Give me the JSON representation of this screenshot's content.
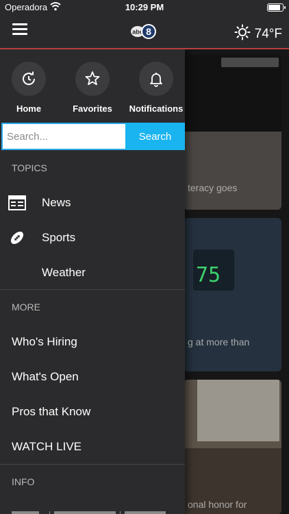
{
  "status_bar": {
    "carrier": "Operadora",
    "time": "10:29 PM"
  },
  "header": {
    "menu_icon": "hamburger-icon",
    "logo_icon": "abc8-logo",
    "weather_icon": "sun-icon",
    "temperature": "74°F"
  },
  "drawer": {
    "quick_actions": [
      {
        "label": "Home",
        "icon": "history-icon"
      },
      {
        "label": "Favorites",
        "icon": "star-icon"
      },
      {
        "label": "Notifications",
        "icon": "bell-icon"
      }
    ],
    "search": {
      "placeholder": "Search...",
      "button_label": "Search"
    },
    "topics": {
      "heading": "TOPICS",
      "items": [
        {
          "label": "News",
          "icon": "newspaper-icon"
        },
        {
          "label": "Sports",
          "icon": "football-icon"
        },
        {
          "label": "Weather",
          "icon": ""
        }
      ]
    },
    "more": {
      "heading": "MORE",
      "items": [
        {
          "label": "Who's Hiring"
        },
        {
          "label": "What's Open"
        },
        {
          "label": "Pros that Know"
        },
        {
          "label": "WATCH LIVE"
        }
      ]
    },
    "info": {
      "heading": "INFO"
    }
  },
  "background_cards": [
    {
      "caption": "teracy goes"
    },
    {
      "caption": "g at more than"
    },
    {
      "caption": "onal honor for"
    }
  ],
  "colors": {
    "accent_blue": "#1ab4f0",
    "header_line": "#b6403f",
    "drawer_bg": "#2b2b2d"
  }
}
